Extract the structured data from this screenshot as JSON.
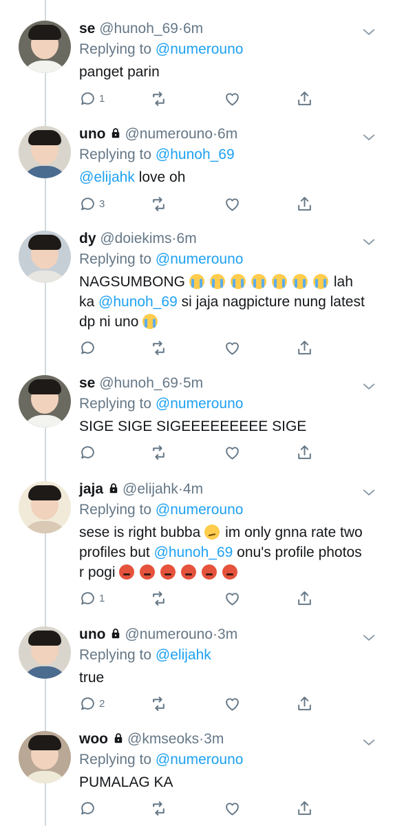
{
  "colors": {
    "accent": "#1da1f2",
    "secondary_text": "#657786",
    "thread_line": "#cfd9de"
  },
  "tweets": [
    {
      "name": "se",
      "handle": "@hunoh_69",
      "time": "6m",
      "locked": false,
      "reply_prefix": "Replying to",
      "reply_to": "@numerouno",
      "segments": [
        {
          "text": "panget parin"
        }
      ],
      "reply_count": "1",
      "avatar": "se-avatar"
    },
    {
      "name": "uno",
      "handle": "@numerouno",
      "time": "6m",
      "locked": true,
      "reply_prefix": "Replying to",
      "reply_to": "@hunoh_69",
      "segments": [
        {
          "text": "@elijahk",
          "type": "mention"
        },
        {
          "text": " love oh"
        }
      ],
      "reply_count": "3",
      "avatar": "uno-avatar"
    },
    {
      "name": "dy",
      "handle": "@doiekims",
      "time": "6m",
      "locked": false,
      "reply_prefix": "Replying to",
      "reply_to": "@numerouno",
      "segments": [
        {
          "text": "NAGSUMBONG "
        },
        {
          "emoji": "cry"
        },
        {
          "emoji": "cry"
        },
        {
          "emoji": "cry"
        },
        {
          "emoji": "cry"
        },
        {
          "emoji": "cry"
        },
        {
          "emoji": "cry"
        },
        {
          "emoji": "cry"
        },
        {
          "text": "lah ka "
        },
        {
          "text": "@hunoh_69",
          "type": "mention"
        },
        {
          "text": " si jaja nagpicture nung latest dp ni uno "
        },
        {
          "emoji": "cry"
        }
      ],
      "reply_count": "",
      "avatar": "dy-avatar"
    },
    {
      "name": "se",
      "handle": "@hunoh_69",
      "time": "5m",
      "locked": false,
      "reply_prefix": "Replying to",
      "reply_to": "@numerouno",
      "segments": [
        {
          "text": "SIGE SIGE SIGEEEEEEEEE SIGE"
        }
      ],
      "reply_count": "",
      "avatar": "se-avatar"
    },
    {
      "name": "jaja",
      "handle": "@elijahk",
      "time": "4m",
      "locked": true,
      "reply_prefix": "Replying to",
      "reply_to": "@numerouno",
      "segments": [
        {
          "text": "sese is right bubba "
        },
        {
          "emoji": "confused"
        },
        {
          "text": "im only gnna rate two profiles but "
        },
        {
          "text": "@hunoh_69",
          "type": "mention"
        },
        {
          "text": " onu's profile photos r pogi "
        },
        {
          "emoji": "angry"
        },
        {
          "emoji": "angry"
        },
        {
          "emoji": "angry"
        },
        {
          "emoji": "angry"
        },
        {
          "emoji": "angry"
        },
        {
          "emoji": "angry"
        }
      ],
      "reply_count": "1",
      "avatar": "jaja-avatar"
    },
    {
      "name": "uno",
      "handle": "@numerouno",
      "time": "3m",
      "locked": true,
      "reply_prefix": "Replying to",
      "reply_to": "@elijahk",
      "segments": [
        {
          "text": "true"
        }
      ],
      "reply_count": "2",
      "avatar": "uno-avatar"
    },
    {
      "name": "woo",
      "handle": "@kmseoks",
      "time": "3m",
      "locked": true,
      "reply_prefix": "Replying to",
      "reply_to": "@numerouno",
      "segments": [
        {
          "text": "PUMALAG KA"
        }
      ],
      "reply_count": "",
      "avatar": "woo-avatar"
    }
  ],
  "icons": {
    "reply": "speech-bubble-icon",
    "retweet": "retweet-icon",
    "like": "heart-icon",
    "share": "share-icon",
    "more": "chevron-down-icon",
    "locked": "lock-icon"
  }
}
